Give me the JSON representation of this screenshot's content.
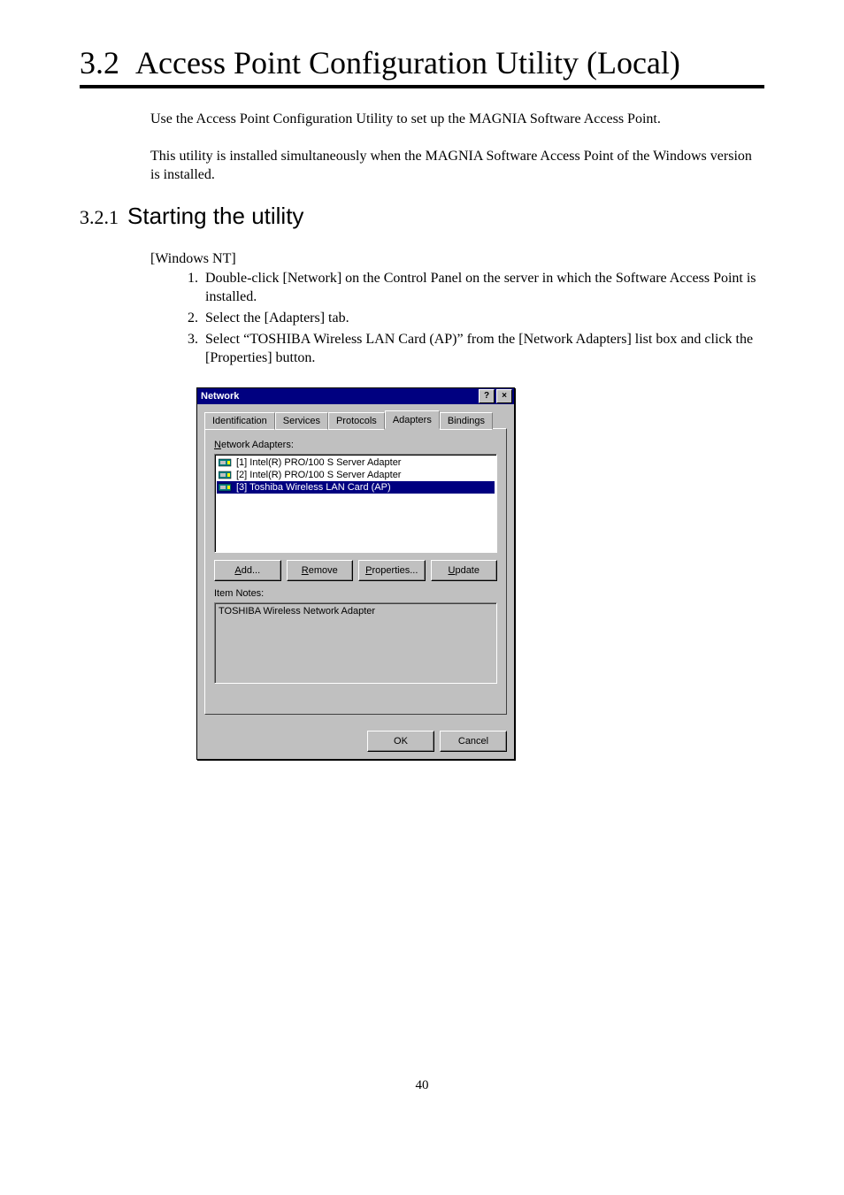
{
  "heading": {
    "number": "3.2",
    "title": "Access Point Configuration Utility (Local)"
  },
  "intro": {
    "p1": "Use the Access Point Configuration Utility to set up the MAGNIA Software Access Point.",
    "p2": "This utility is installed simultaneously when the MAGNIA Software Access Point of the Windows version is installed."
  },
  "subsection": {
    "number": "3.2.1",
    "title": "Starting the utility"
  },
  "platform": "[Windows NT]",
  "steps": [
    "Double-click [Network] on the Control Panel on the server in which the Software Access Point is installed.",
    "Select the [Adapters] tab.",
    "Select “TOSHIBA Wireless LAN Card (AP)” from the [Network Adapters] list box and click the [Properties] button."
  ],
  "dialog": {
    "title": "Network",
    "help_glyph": "?",
    "close_glyph": "×",
    "tabs": {
      "identification": "Identification",
      "services": "Services",
      "protocols": "Protocols",
      "adapters": "Adapters",
      "bindings": "Bindings"
    },
    "adapters_label_pre": "N",
    "adapters_label_post": "etwork Adapters:",
    "adapters": [
      {
        "text": "[1] Intel(R) PRO/100 S Server Adapter",
        "selected": false
      },
      {
        "text": "[2] Intel(R) PRO/100 S Server Adapter",
        "selected": false
      },
      {
        "text": "[3] Toshiba Wireless LAN Card (AP)",
        "selected": true
      }
    ],
    "buttons": {
      "add_u": "A",
      "add_rest": "dd...",
      "remove_u": "R",
      "remove_rest": "emove",
      "properties_u": "P",
      "properties_rest": "roperties...",
      "update_u": "U",
      "update_rest": "pdate"
    },
    "item_notes_label": "Item Notes:",
    "item_notes_value": "TOSHIBA Wireless Network Adapter",
    "ok": "OK",
    "cancel": "Cancel"
  },
  "page_number": "40"
}
